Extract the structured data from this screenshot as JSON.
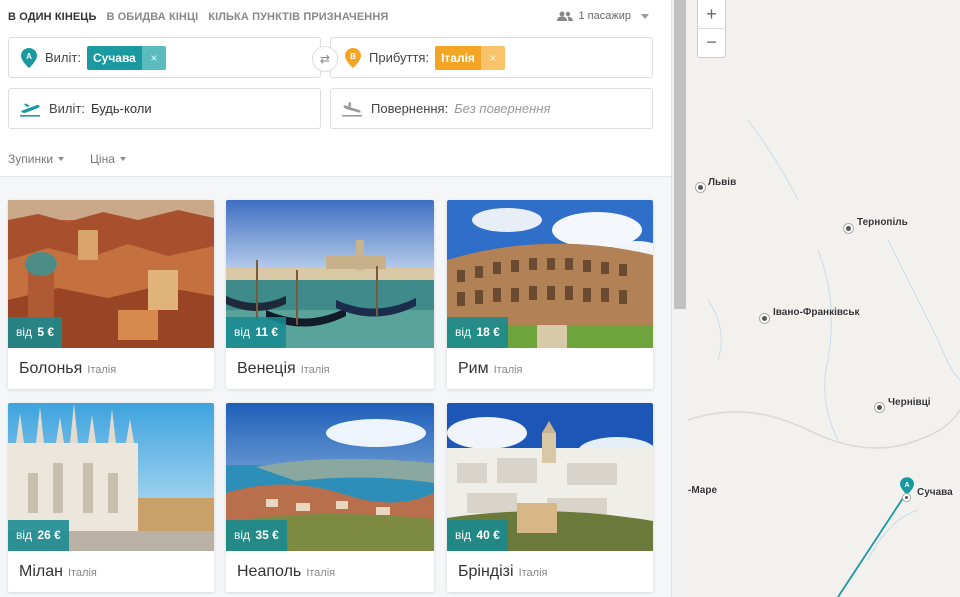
{
  "tabs": [
    {
      "label": "В ОДИН КІНЕЦЬ"
    },
    {
      "label": "В ОБИДВА КІНЦІ"
    },
    {
      "label": "КІЛЬКА ПУНКТІВ ПРИЗНАЧЕННЯ"
    }
  ],
  "passengers": "1 пасажир",
  "search": {
    "from_label": "Виліт:",
    "from_value": "Сучава",
    "to_label": "Прибуття:",
    "to_value": "Італія",
    "depart_label": "Виліт:",
    "depart_value": "Будь-коли",
    "return_label": "Повернення:",
    "return_placeholder": "Без повернення",
    "pin_a": "A",
    "pin_b": "B",
    "remove": "×",
    "swap": "⇄"
  },
  "filters": {
    "stops": "Зупинки",
    "price": "Ціна"
  },
  "price_prefix": "від",
  "cards": [
    {
      "city": "Болонья",
      "country": "Італія",
      "price": "5 €"
    },
    {
      "city": "Венеція",
      "country": "Італія",
      "price": "11 €"
    },
    {
      "city": "Рим",
      "country": "Італія",
      "price": "18 €"
    },
    {
      "city": "Мілан",
      "country": "Італія",
      "price": "26 €"
    },
    {
      "city": "Неаполь",
      "country": "Італія",
      "price": "35 €"
    },
    {
      "city": "Бріндізі",
      "country": "Італія",
      "price": "40 €"
    }
  ],
  "map": {
    "zoom_in": "+",
    "zoom_out": "−",
    "marker_a": "A",
    "cities": [
      "Львів",
      "Тернопіль",
      "Івано-Франківськ",
      "Чернівці",
      "Сучава",
      "-Маре"
    ]
  },
  "colors": {
    "teal": "#1a9aa0",
    "orange": "#f5a524"
  }
}
